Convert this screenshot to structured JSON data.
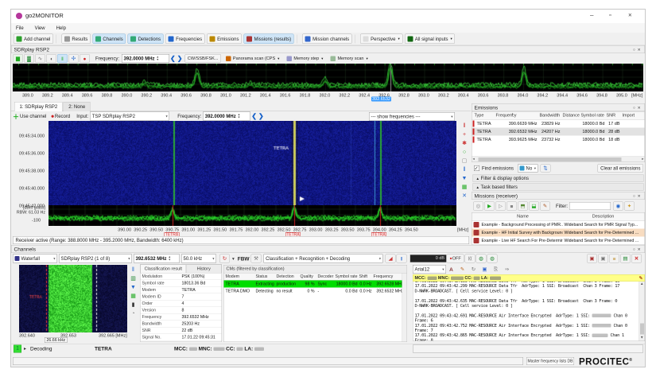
{
  "window": {
    "title": "go2MONITOR",
    "minimize": "–",
    "maximize": "▫",
    "close": "×"
  },
  "menu": [
    "File",
    "View",
    "Help"
  ],
  "toolbar": [
    {
      "label": "Add channel",
      "color": "#2ca02c",
      "active": false,
      "sep_after": true
    },
    {
      "label": "Results",
      "color": "#999999",
      "active": false
    },
    {
      "label": "Channels",
      "color": "#33aa77",
      "active": true
    },
    {
      "label": "Detections",
      "color": "#33aa77",
      "active": true
    },
    {
      "label": "Frequencies",
      "color": "#2266cc",
      "active": false
    },
    {
      "label": "Emissions",
      "color": "#bb8800",
      "active": false
    },
    {
      "label": "Missions (results)",
      "color": "#aa3333",
      "active": true,
      "sep_after": true
    },
    {
      "label": "Mission channels",
      "color": "#3366cc",
      "active": false,
      "sep_after": true
    },
    {
      "label": "Perspective",
      "color": "#dddddd",
      "active": false,
      "dropdown": true
    },
    {
      "label": "All signal inputs",
      "color": "#116611",
      "active": false,
      "dropdown": true
    }
  ],
  "receiver": {
    "title": "SDRplay RSP2",
    "frequency_label": "Frequency:",
    "frequency_value": "392.0000 MHz",
    "demod_button": "CW/SSB/FSK...",
    "panorama_scan": "Panorama scan (CPS",
    "memory_step": "Memory step",
    "memory_scan": "Memory scan",
    "axis": {
      "start": 389.0,
      "step": 0.2,
      "count": 31,
      "unit": "[MHz]"
    },
    "selected_frequency": "392.6532"
  },
  "wideband": {
    "tabs": [
      "1: SDRplay RSP2",
      "2: None"
    ],
    "use_channel": "Use channel",
    "record": "Record",
    "input_label": "Input:",
    "input_value": "TSP SDRplay RSP2",
    "frequency_label": "Frequency:",
    "frequency_value": "392.0000 MHz",
    "show_frequencies": "--- show frequencies ---",
    "timestamps": [
      "09:45:34.000",
      "09:45:36.000",
      "09:45:38.000",
      "09:45:40.000",
      "09:45:42.000"
    ],
    "wf_label": "TETRA",
    "spec_unit": "[dBm grass]",
    "spec_rbw": "RBW: 61.03 Hz",
    "spec_level": "-100",
    "axis": {
      "start": 390.0,
      "step": 0.25,
      "count": 19
    },
    "markers": [
      {
        "freq": 390.75,
        "label": "TETRA"
      },
      {
        "freq": 392.6532,
        "label": "TETRA"
      },
      {
        "freq": 394.0,
        "label": "TETRA"
      }
    ],
    "status": "Receiver active (Range: 388.8000 MHz - 395.2000 MHz, Bandwidth: 6400 kHz)"
  },
  "emissions": {
    "title": "Emissions",
    "columns": [
      "Type",
      "Frequency",
      "Bandwidth",
      "Distance [°",
      "Symbol rate",
      "SNR",
      "Import"
    ],
    "rows": [
      {
        "type": "TETRA",
        "frequency": "390.6639 MHz",
        "bandwidth": "23829 Hz",
        "symbol_rate": "18000.0 Bd",
        "snr": "17 dB",
        "selected": false
      },
      {
        "type": "TETRA",
        "frequency": "392.6532 MHz",
        "bandwidth": "24207 Hz",
        "symbol_rate": "18000.0 Bd",
        "snr": "28 dB",
        "selected": true
      },
      {
        "type": "TETRA",
        "frequency": "393.9625 MHz",
        "bandwidth": "23732 Hz",
        "symbol_rate": "18000.0 Bd",
        "snr": "18 dB",
        "selected": false
      }
    ],
    "find_label": "Find emissions",
    "find_mode": "No",
    "clear_button": "Clear all emissions",
    "filter_options": "Filter & display options",
    "task_filters": "Task based filters"
  },
  "missions": {
    "title": "Missions (receiver)",
    "filter_label": "Filter:",
    "columns": [
      "Name",
      "Description"
    ],
    "rows": [
      {
        "name": "Example - Background Processing of PMR...",
        "description": "Wideband Search for PMR Signal Typ...",
        "selected": false
      },
      {
        "name": "Example - HF Initial Survey with Background ...",
        "description": "Wideband Search for Pre-Determined ...",
        "selected": true
      },
      {
        "name": "Example - Live HF Search For Pre-Determined ...",
        "description": "Wideband Search for Pre-Determined ...",
        "selected": false
      }
    ]
  },
  "channels": {
    "title": "Channels",
    "view_mode": "Waterfall",
    "input": "SDRplay RSP2 (1 of 8)",
    "frequency": "392.6532 MHz",
    "bandwidth": "50.0 kHz",
    "fbw": "FBW",
    "processing": "Classification + Recognition + Decoding",
    "level": "0 dB",
    "off": "OFF",
    "wf_axis": [
      "392.640",
      "392.653",
      "392.665 [MHz]"
    ],
    "wf_bw": "26.66 kHz",
    "wf_marker": "TETRA"
  },
  "classification": {
    "tabs": [
      "Classification result",
      "History"
    ],
    "rows": [
      {
        "label": "Modulation",
        "value": "PSK (100%)"
      },
      {
        "label": "Symbol rate",
        "value": "18013.36 Bd"
      },
      {
        "label": "Modem",
        "value": "TETRA"
      },
      {
        "label": "Modem ID",
        "value": "7"
      },
      {
        "label": "Order",
        "value": "4"
      },
      {
        "label": "Version",
        "value": "8"
      },
      {
        "label": "Frequency",
        "value": "392.6532 MHz"
      },
      {
        "label": "Bandwidth",
        "value": "25203 Hz"
      },
      {
        "label": "SNR",
        "value": "22 dB"
      },
      {
        "label": "Signal No.",
        "value": "17.01.22 09:45:31"
      }
    ]
  },
  "cms": {
    "title": "CMs (filtered by classification)",
    "columns": [
      "Modem",
      "Status",
      "Detection",
      "Quality",
      "Decoder",
      "Symbol rate",
      "Shift",
      "Frequency"
    ],
    "rows": [
      {
        "cells": [
          "TETRA",
          "Extracting",
          "production",
          "98 %",
          "Sync",
          "18000.0 Bd",
          "0.0 Hz",
          "392.6528 MHz"
        ],
        "highlight": true
      },
      {
        "cells": [
          "TETRA DMO",
          "Detecting",
          "no result",
          "0 %",
          "-",
          "0.0 Bd",
          "0.0 Hz",
          "392.6532 MHz"
        ],
        "highlight": false
      }
    ]
  },
  "decoder": {
    "font_select": "Arial12",
    "mcc_line": [
      {
        "t": "MCC: "
      },
      {
        "r": 24
      },
      {
        "t": " MNC: "
      },
      {
        "r": 32
      },
      {
        "t": " CC: "
      },
      {
        "r": 16
      },
      {
        "t": " LA: "
      },
      {
        "r": 28
      }
    ],
    "lines": [
      {
        "segs": [
          {
            "t": "17.01.2022 09:43:42.133 MAC-RESOURCE Data Tfr  AdrType: 1 SSI: Broadcast  Chan 3 Frame: 16"
          }
        ]
      },
      {
        "segs": [
          {
            "t": "17.01.2022 09:43:42.299 MAC-RESOURCE Data Tfr  AdrType: 1 SSI: Broadcast  Chan 3 Frame: 17"
          }
        ]
      },
      {
        "segs": [
          {
            "t": "D-NWRK-BROADCAST. [ Cell service Level: 0 ]"
          }
        ]
      },
      {
        "segs": [
          {
            "t": " "
          }
        ]
      },
      {
        "segs": [
          {
            "t": "17.01.2022 09:43:42.635 MAC-RESOURCE Data Tfr  AdrType: 1 SSI: Broadcast  Chan 3 Frame: 0"
          }
        ]
      },
      {
        "segs": [
          {
            "t": "D-NWRK-BROADCAST. [ Cell service Level: 0 ]"
          }
        ]
      },
      {
        "segs": [
          {
            "t": " "
          }
        ]
      },
      {
        "segs": [
          {
            "t": "17.01.2022 09:43:42.691 MAC-RESOURCE Air Interface Encrypted  AdrType: 1 SSI: "
          },
          {
            "r": 48
          },
          {
            "t": " Chan 0"
          }
        ]
      },
      {
        "segs": [
          {
            "t": "Frame: 6"
          }
        ]
      },
      {
        "segs": [
          {
            "t": "17.01.2022 09:43:42.752 MAC-RESOURCE Air Interface Encrypted  AdrType: 1 SSI: "
          },
          {
            "r": 48
          },
          {
            "t": " Chan 0"
          }
        ]
      },
      {
        "segs": [
          {
            "t": "Frame: 7"
          }
        ]
      },
      {
        "segs": [
          {
            "t": "17.01.2022 09:43:42.865 MAC-RESOURCE Air Interface Encrypted  AdrType: 1 SSI: "
          },
          {
            "r": 40
          },
          {
            "t": " Chan 1"
          }
        ]
      },
      {
        "segs": [
          {
            "t": "Frame: 8"
          }
        ]
      }
    ]
  },
  "status_row": {
    "state": "Decoding",
    "modem": "TETRA",
    "info": [
      {
        "t": "MCC: "
      },
      {
        "r": 20
      },
      {
        "t": " MNC: "
      },
      {
        "r": 28
      },
      {
        "t": " CC: "
      },
      {
        "r": 16
      },
      {
        "t": " LA: "
      },
      {
        "r": 24
      }
    ]
  },
  "statusbar": {
    "db_label": "Master frequency lists DB",
    "logo": "PROCITEC",
    "logo_sup": "®"
  }
}
